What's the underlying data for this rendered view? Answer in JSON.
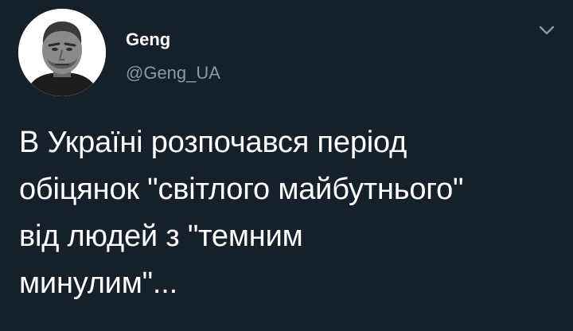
{
  "colors": {
    "background": "#15202b",
    "primary_text": "#ffffff",
    "secondary_text": "#8899a6"
  },
  "author": {
    "display_name": "Geng",
    "handle": "@Geng_UA",
    "avatar_icon": "profile-photo"
  },
  "header": {
    "menu_icon": "chevron-down-icon"
  },
  "tweet": {
    "lines": [
      "В Україні розпочався період",
      "обіцянок \"світлого майбутнього\"",
      "від людей з \"темним",
      "минулим\"..."
    ]
  }
}
